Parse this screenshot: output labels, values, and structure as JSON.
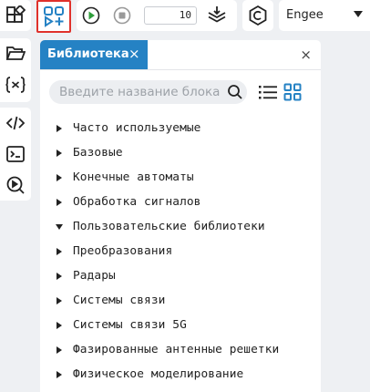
{
  "toolbar": {
    "steps_value": "10",
    "engine": "Engee"
  },
  "library": {
    "tab_label": "Библиотека",
    "tab_close": "×",
    "panel_close": "×",
    "search_placeholder": "Введите название блока",
    "categories": [
      {
        "label": "Часто используемые",
        "expanded": false
      },
      {
        "label": "Базовые",
        "expanded": false
      },
      {
        "label": "Конечные автоматы",
        "expanded": false
      },
      {
        "label": "Обработка сигналов",
        "expanded": false
      },
      {
        "label": "Пользовательские библиотеки",
        "expanded": true
      },
      {
        "label": "Преобразования",
        "expanded": false
      },
      {
        "label": "Радары",
        "expanded": false
      },
      {
        "label": "Системы связи",
        "expanded": false
      },
      {
        "label": "Системы связи 5G",
        "expanded": false
      },
      {
        "label": "Фазированные антенные решетки",
        "expanded": false
      },
      {
        "label": "Физическое моделирование",
        "expanded": false
      }
    ]
  },
  "colors": {
    "accent": "#2582c4",
    "run_green": "#2e9e3a",
    "highlight_border": "#e0312b"
  }
}
